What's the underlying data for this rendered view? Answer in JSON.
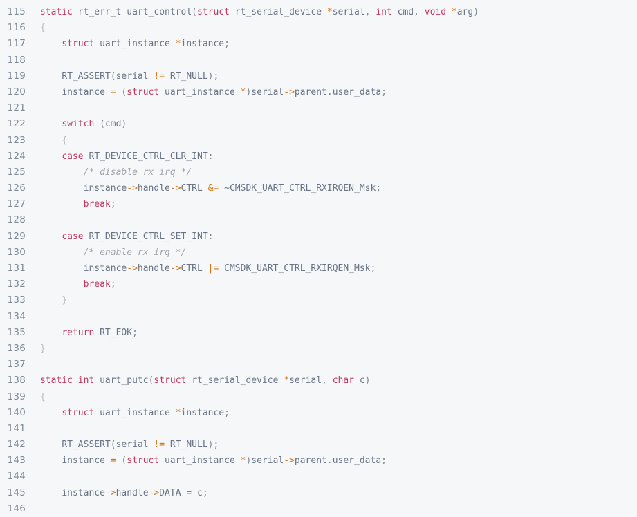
{
  "viewer": {
    "name": "source-code-viewer",
    "language": "C",
    "first_line_number": 115,
    "last_line_number": 146,
    "background_color": "#f6f7f8",
    "gutter_color": "#7f8a99",
    "divider_color": "#dcdfe3"
  },
  "palette": {
    "keyword": "#c0385e",
    "identifier": "#6a7487",
    "operator": "#d2741a",
    "punctuation": "#7e8794",
    "brace": "#b8bcc4",
    "comment": "#a0a4ab",
    "text": "#5f6773"
  },
  "line_numbers": [
    "115",
    "116",
    "117",
    "118",
    "119",
    "120",
    "121",
    "122",
    "123",
    "124",
    "125",
    "126",
    "127",
    "128",
    "129",
    "130",
    "131",
    "132",
    "133",
    "134",
    "135",
    "136",
    "137",
    "138",
    "139",
    "140",
    "141",
    "142",
    "143",
    "144",
    "145",
    "146"
  ],
  "lines": [
    {
      "number": "115",
      "text": "static rt_err_t uart_control(struct rt_serial_device *serial, int cmd, void *arg)",
      "tokens": [
        {
          "t": "static",
          "c": "kw"
        },
        {
          "t": " ",
          "c": "txt"
        },
        {
          "t": "rt_err_t",
          "c": "id"
        },
        {
          "t": " ",
          "c": "txt"
        },
        {
          "t": "uart_control",
          "c": "id"
        },
        {
          "t": "(",
          "c": "pun"
        },
        {
          "t": "struct",
          "c": "kw"
        },
        {
          "t": " ",
          "c": "txt"
        },
        {
          "t": "rt_serial_device",
          "c": "id"
        },
        {
          "t": " ",
          "c": "txt"
        },
        {
          "t": "*",
          "c": "op"
        },
        {
          "t": "serial",
          "c": "id"
        },
        {
          "t": ", ",
          "c": "pun"
        },
        {
          "t": "int",
          "c": "kw"
        },
        {
          "t": " ",
          "c": "txt"
        },
        {
          "t": "cmd",
          "c": "id"
        },
        {
          "t": ", ",
          "c": "pun"
        },
        {
          "t": "void",
          "c": "kw"
        },
        {
          "t": " ",
          "c": "txt"
        },
        {
          "t": "*",
          "c": "op"
        },
        {
          "t": "arg",
          "c": "id"
        },
        {
          "t": ")",
          "c": "pun"
        }
      ]
    },
    {
      "number": "116",
      "text": "{",
      "tokens": [
        {
          "t": "{",
          "c": "brace"
        }
      ]
    },
    {
      "number": "117",
      "text": "    struct uart_instance *instance;",
      "tokens": [
        {
          "t": "    ",
          "c": "txt"
        },
        {
          "t": "struct",
          "c": "kw"
        },
        {
          "t": " ",
          "c": "txt"
        },
        {
          "t": "uart_instance",
          "c": "id"
        },
        {
          "t": " ",
          "c": "txt"
        },
        {
          "t": "*",
          "c": "op"
        },
        {
          "t": "instance",
          "c": "id"
        },
        {
          "t": ";",
          "c": "pun"
        }
      ]
    },
    {
      "number": "118",
      "text": "",
      "tokens": []
    },
    {
      "number": "119",
      "text": "    RT_ASSERT(serial != RT_NULL);",
      "tokens": [
        {
          "t": "    ",
          "c": "txt"
        },
        {
          "t": "RT_ASSERT",
          "c": "id"
        },
        {
          "t": "(",
          "c": "pun"
        },
        {
          "t": "serial",
          "c": "id"
        },
        {
          "t": " ",
          "c": "txt"
        },
        {
          "t": "!=",
          "c": "op"
        },
        {
          "t": " ",
          "c": "txt"
        },
        {
          "t": "RT_NULL",
          "c": "id"
        },
        {
          "t": ");",
          "c": "pun"
        }
      ]
    },
    {
      "number": "120",
      "text": "    instance = (struct uart_instance *)serial->parent.user_data;",
      "tokens": [
        {
          "t": "    ",
          "c": "txt"
        },
        {
          "t": "instance",
          "c": "id"
        },
        {
          "t": " ",
          "c": "txt"
        },
        {
          "t": "=",
          "c": "op"
        },
        {
          "t": " ",
          "c": "txt"
        },
        {
          "t": "(",
          "c": "pun"
        },
        {
          "t": "struct",
          "c": "kw"
        },
        {
          "t": " ",
          "c": "txt"
        },
        {
          "t": "uart_instance",
          "c": "id"
        },
        {
          "t": " ",
          "c": "txt"
        },
        {
          "t": "*",
          "c": "op"
        },
        {
          "t": ")",
          "c": "pun"
        },
        {
          "t": "serial",
          "c": "id"
        },
        {
          "t": "->",
          "c": "op"
        },
        {
          "t": "parent",
          "c": "id"
        },
        {
          "t": ".",
          "c": "pun"
        },
        {
          "t": "user_data",
          "c": "id"
        },
        {
          "t": ";",
          "c": "pun"
        }
      ]
    },
    {
      "number": "121",
      "text": "",
      "tokens": []
    },
    {
      "number": "122",
      "text": "    switch (cmd)",
      "tokens": [
        {
          "t": "    ",
          "c": "txt"
        },
        {
          "t": "switch",
          "c": "kw"
        },
        {
          "t": " ",
          "c": "txt"
        },
        {
          "t": "(",
          "c": "pun"
        },
        {
          "t": "cmd",
          "c": "id"
        },
        {
          "t": ")",
          "c": "pun"
        }
      ]
    },
    {
      "number": "123",
      "text": "    {",
      "tokens": [
        {
          "t": "    ",
          "c": "txt"
        },
        {
          "t": "{",
          "c": "brace"
        }
      ]
    },
    {
      "number": "124",
      "text": "    case RT_DEVICE_CTRL_CLR_INT:",
      "tokens": [
        {
          "t": "    ",
          "c": "txt"
        },
        {
          "t": "case",
          "c": "kw"
        },
        {
          "t": " ",
          "c": "txt"
        },
        {
          "t": "RT_DEVICE_CTRL_CLR_INT",
          "c": "id"
        },
        {
          "t": ":",
          "c": "pun"
        }
      ]
    },
    {
      "number": "125",
      "text": "        /* disable rx irq */",
      "tokens": [
        {
          "t": "        ",
          "c": "txt"
        },
        {
          "t": "/* disable rx irq */",
          "c": "cmt"
        }
      ]
    },
    {
      "number": "126",
      "text": "        instance->handle->CTRL &= ~CMSDK_UART_CTRL_RXIRQEN_Msk;",
      "tokens": [
        {
          "t": "        ",
          "c": "txt"
        },
        {
          "t": "instance",
          "c": "id"
        },
        {
          "t": "->",
          "c": "op"
        },
        {
          "t": "handle",
          "c": "id"
        },
        {
          "t": "->",
          "c": "op"
        },
        {
          "t": "CTRL",
          "c": "id"
        },
        {
          "t": " ",
          "c": "txt"
        },
        {
          "t": "&=",
          "c": "op"
        },
        {
          "t": " ",
          "c": "txt"
        },
        {
          "t": "~CMSDK_UART_CTRL_RXIRQEN_Msk",
          "c": "id"
        },
        {
          "t": ";",
          "c": "pun"
        }
      ]
    },
    {
      "number": "127",
      "text": "        break;",
      "tokens": [
        {
          "t": "        ",
          "c": "txt"
        },
        {
          "t": "break",
          "c": "kw"
        },
        {
          "t": ";",
          "c": "pun"
        }
      ]
    },
    {
      "number": "128",
      "text": "",
      "tokens": []
    },
    {
      "number": "129",
      "text": "    case RT_DEVICE_CTRL_SET_INT:",
      "tokens": [
        {
          "t": "    ",
          "c": "txt"
        },
        {
          "t": "case",
          "c": "kw"
        },
        {
          "t": " ",
          "c": "txt"
        },
        {
          "t": "RT_DEVICE_CTRL_SET_INT",
          "c": "id"
        },
        {
          "t": ":",
          "c": "pun"
        }
      ]
    },
    {
      "number": "130",
      "text": "        /* enable rx irq */",
      "tokens": [
        {
          "t": "        ",
          "c": "txt"
        },
        {
          "t": "/* enable rx irq */",
          "c": "cmt"
        }
      ]
    },
    {
      "number": "131",
      "text": "        instance->handle->CTRL |= CMSDK_UART_CTRL_RXIRQEN_Msk;",
      "tokens": [
        {
          "t": "        ",
          "c": "txt"
        },
        {
          "t": "instance",
          "c": "id"
        },
        {
          "t": "->",
          "c": "op"
        },
        {
          "t": "handle",
          "c": "id"
        },
        {
          "t": "->",
          "c": "op"
        },
        {
          "t": "CTRL",
          "c": "id"
        },
        {
          "t": " ",
          "c": "txt"
        },
        {
          "t": "|=",
          "c": "op"
        },
        {
          "t": " ",
          "c": "txt"
        },
        {
          "t": "CMSDK_UART_CTRL_RXIRQEN_Msk",
          "c": "id"
        },
        {
          "t": ";",
          "c": "pun"
        }
      ]
    },
    {
      "number": "132",
      "text": "        break;",
      "tokens": [
        {
          "t": "        ",
          "c": "txt"
        },
        {
          "t": "break",
          "c": "kw"
        },
        {
          "t": ";",
          "c": "pun"
        }
      ]
    },
    {
      "number": "133",
      "text": "    }",
      "tokens": [
        {
          "t": "    ",
          "c": "txt"
        },
        {
          "t": "}",
          "c": "brace"
        }
      ]
    },
    {
      "number": "134",
      "text": "",
      "tokens": []
    },
    {
      "number": "135",
      "text": "    return RT_EOK;",
      "tokens": [
        {
          "t": "    ",
          "c": "txt"
        },
        {
          "t": "return",
          "c": "kw"
        },
        {
          "t": " ",
          "c": "txt"
        },
        {
          "t": "RT_EOK",
          "c": "id"
        },
        {
          "t": ";",
          "c": "pun"
        }
      ]
    },
    {
      "number": "136",
      "text": "}",
      "tokens": [
        {
          "t": "}",
          "c": "brace"
        }
      ]
    },
    {
      "number": "137",
      "text": "",
      "tokens": []
    },
    {
      "number": "138",
      "text": "static int uart_putc(struct rt_serial_device *serial, char c)",
      "tokens": [
        {
          "t": "static",
          "c": "kw"
        },
        {
          "t": " ",
          "c": "txt"
        },
        {
          "t": "int",
          "c": "kw"
        },
        {
          "t": " ",
          "c": "txt"
        },
        {
          "t": "uart_putc",
          "c": "id"
        },
        {
          "t": "(",
          "c": "pun"
        },
        {
          "t": "struct",
          "c": "kw"
        },
        {
          "t": " ",
          "c": "txt"
        },
        {
          "t": "rt_serial_device",
          "c": "id"
        },
        {
          "t": " ",
          "c": "txt"
        },
        {
          "t": "*",
          "c": "op"
        },
        {
          "t": "serial",
          "c": "id"
        },
        {
          "t": ", ",
          "c": "pun"
        },
        {
          "t": "char",
          "c": "kw"
        },
        {
          "t": " ",
          "c": "txt"
        },
        {
          "t": "c",
          "c": "id"
        },
        {
          "t": ")",
          "c": "pun"
        }
      ]
    },
    {
      "number": "139",
      "text": "{",
      "tokens": [
        {
          "t": "{",
          "c": "brace"
        }
      ]
    },
    {
      "number": "140",
      "text": "    struct uart_instance *instance;",
      "tokens": [
        {
          "t": "    ",
          "c": "txt"
        },
        {
          "t": "struct",
          "c": "kw"
        },
        {
          "t": " ",
          "c": "txt"
        },
        {
          "t": "uart_instance",
          "c": "id"
        },
        {
          "t": " ",
          "c": "txt"
        },
        {
          "t": "*",
          "c": "op"
        },
        {
          "t": "instance",
          "c": "id"
        },
        {
          "t": ";",
          "c": "pun"
        }
      ]
    },
    {
      "number": "141",
      "text": "",
      "tokens": []
    },
    {
      "number": "142",
      "text": "    RT_ASSERT(serial != RT_NULL);",
      "tokens": [
        {
          "t": "    ",
          "c": "txt"
        },
        {
          "t": "RT_ASSERT",
          "c": "id"
        },
        {
          "t": "(",
          "c": "pun"
        },
        {
          "t": "serial",
          "c": "id"
        },
        {
          "t": " ",
          "c": "txt"
        },
        {
          "t": "!=",
          "c": "op"
        },
        {
          "t": " ",
          "c": "txt"
        },
        {
          "t": "RT_NULL",
          "c": "id"
        },
        {
          "t": ");",
          "c": "pun"
        }
      ]
    },
    {
      "number": "143",
      "text": "    instance = (struct uart_instance *)serial->parent.user_data;",
      "tokens": [
        {
          "t": "    ",
          "c": "txt"
        },
        {
          "t": "instance",
          "c": "id"
        },
        {
          "t": " ",
          "c": "txt"
        },
        {
          "t": "=",
          "c": "op"
        },
        {
          "t": " ",
          "c": "txt"
        },
        {
          "t": "(",
          "c": "pun"
        },
        {
          "t": "struct",
          "c": "kw"
        },
        {
          "t": " ",
          "c": "txt"
        },
        {
          "t": "uart_instance",
          "c": "id"
        },
        {
          "t": " ",
          "c": "txt"
        },
        {
          "t": "*",
          "c": "op"
        },
        {
          "t": ")",
          "c": "pun"
        },
        {
          "t": "serial",
          "c": "id"
        },
        {
          "t": "->",
          "c": "op"
        },
        {
          "t": "parent",
          "c": "id"
        },
        {
          "t": ".",
          "c": "pun"
        },
        {
          "t": "user_data",
          "c": "id"
        },
        {
          "t": ";",
          "c": "pun"
        }
      ]
    },
    {
      "number": "144",
      "text": "",
      "tokens": []
    },
    {
      "number": "145",
      "text": "    instance->handle->DATA = c;",
      "tokens": [
        {
          "t": "    ",
          "c": "txt"
        },
        {
          "t": "instance",
          "c": "id"
        },
        {
          "t": "->",
          "c": "op"
        },
        {
          "t": "handle",
          "c": "id"
        },
        {
          "t": "->",
          "c": "op"
        },
        {
          "t": "DATA",
          "c": "id"
        },
        {
          "t": " ",
          "c": "txt"
        },
        {
          "t": "=",
          "c": "op"
        },
        {
          "t": " ",
          "c": "txt"
        },
        {
          "t": "c",
          "c": "id"
        },
        {
          "t": ";",
          "c": "pun"
        }
      ]
    },
    {
      "number": "146",
      "text": "",
      "tokens": []
    }
  ]
}
